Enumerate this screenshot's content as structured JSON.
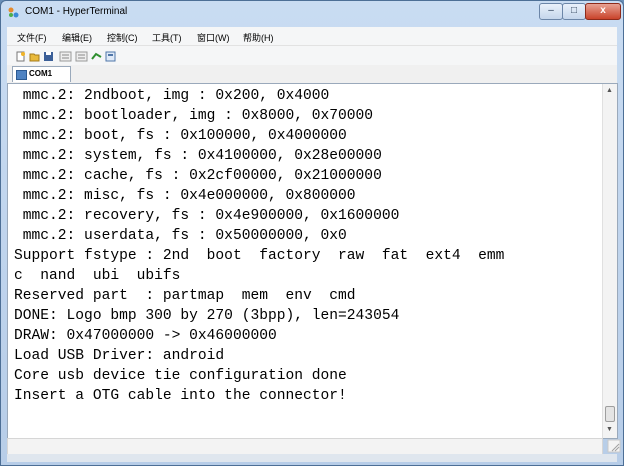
{
  "window": {
    "title": "COM1 - HyperTerminal"
  },
  "window_controls": {
    "minimize": "–",
    "maximize": "□",
    "close": "x"
  },
  "menu": [
    "文件(F)",
    "编辑(E)",
    "控制(C)",
    "工具(T)",
    "窗口(W)",
    "帮助(H)"
  ],
  "toolbar": {
    "icons": [
      "new-icon",
      "open-icon",
      "save-icon",
      "send-file-icon",
      "receive-file-icon",
      "connect-icon",
      "properties-icon"
    ]
  },
  "tab": {
    "label": "COM1"
  },
  "terminal": {
    "lines": [
      " mmc.2: 2ndboot, img : 0x200, 0x4000",
      " mmc.2: bootloader, img : 0x8000, 0x70000",
      " mmc.2: boot, fs : 0x100000, 0x4000000",
      " mmc.2: system, fs : 0x4100000, 0x28e00000",
      " mmc.2: cache, fs : 0x2cf00000, 0x21000000",
      " mmc.2: misc, fs : 0x4e000000, 0x800000",
      " mmc.2: recovery, fs : 0x4e900000, 0x1600000",
      " mmc.2: userdata, fs : 0x50000000, 0x0",
      "Support fstype : 2nd  boot  factory  raw  fat  ext4  emm",
      "c  nand  ubi  ubifs",
      "Reserved part  : partmap  mem  env  cmd",
      "DONE: Logo bmp 300 by 270 (3bpp), len=243054",
      "DRAW: 0x47000000 -> 0x46000000",
      "Load USB Driver: android",
      "Core usb device tie configuration done",
      "Insert a OTG cable into the connector!"
    ]
  }
}
